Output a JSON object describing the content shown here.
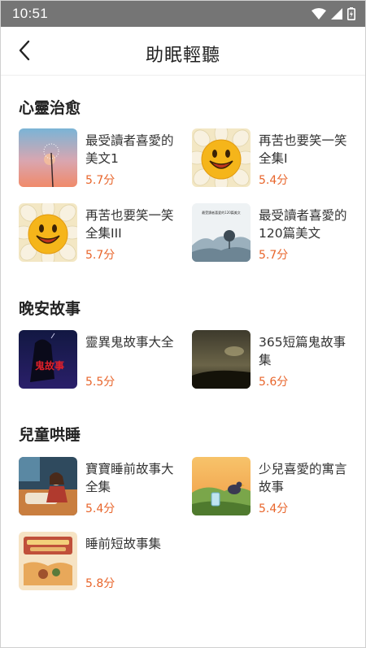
{
  "status_bar": {
    "time": "10:51",
    "icons": [
      "wifi-icon",
      "signal-icon",
      "battery-icon"
    ]
  },
  "header": {
    "title": "助眠輕聽",
    "back_icon": "chevron-left-icon"
  },
  "colors": {
    "score": "#e8652b",
    "status_bar": "#757575"
  },
  "sections": [
    {
      "title": "心靈治愈",
      "items": [
        {
          "title": "最受讀者喜愛的美文1",
          "score": "5.7分",
          "cover": "dandelion-sunset"
        },
        {
          "title": "再苦也要笑一笑全集I",
          "score": "5.4分",
          "cover": "smiley-flower"
        },
        {
          "title": "再苦也要笑一笑全集III",
          "score": "5.7分",
          "cover": "smiley-flower"
        },
        {
          "title": "最受讀者喜愛的120篇美文",
          "score": "5.7分",
          "cover": "ink-landscape",
          "cover_text": "最受讀者喜愛的120篇美文"
        }
      ]
    },
    {
      "title": "晚安故事",
      "items": [
        {
          "title": "靈異鬼故事大全",
          "score": "5.5分",
          "cover": "ghost-story",
          "cover_text": "鬼故事"
        },
        {
          "title": "365短篇鬼故事集",
          "score": "5.6分",
          "cover": "dark-sky"
        }
      ]
    },
    {
      "title": "兒童哄睡",
      "items": [
        {
          "title": "寶寶睡前故事大全集",
          "score": "5.4分",
          "cover": "bedtime-reading"
        },
        {
          "title": "少兒喜愛的寓言故事",
          "score": "5.4分",
          "cover": "fable-bird"
        },
        {
          "title": "睡前短故事集",
          "score": "5.8分",
          "cover": "story-book"
        }
      ]
    }
  ]
}
